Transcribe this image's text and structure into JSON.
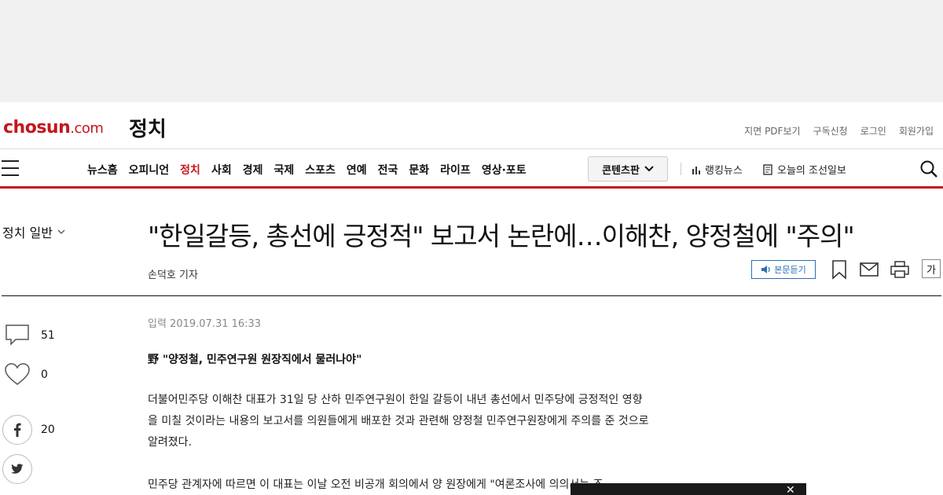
{
  "brand": {
    "logo_main": "chosun",
    "logo_suffix": ".com",
    "section": "정치",
    "accent_color": "#c4161c"
  },
  "util_links": [
    "지면 PDF보기",
    "구독신청",
    "로그인",
    "회원가입"
  ],
  "nav": {
    "items": [
      "뉴스홈",
      "오피니언",
      "정치",
      "사회",
      "경제",
      "국제",
      "스포츠",
      "연예",
      "전국",
      "문화",
      "라이프",
      "영상·포토"
    ],
    "active": "정치",
    "content_button": "콘텐츠판",
    "ranking": "랭킹뉴스",
    "today": "오늘의 조선일보",
    "icons": [
      "hamburger-menu-icon",
      "bar-chart-icon",
      "newspaper-icon",
      "search-icon",
      "chevron-down-icon"
    ]
  },
  "breadcrumb": {
    "label": "정치 일반"
  },
  "article": {
    "headline": "\"한일갈등, 총선에 긍정적\" 보고서 논란에…이해찬, 양정철에 \"주의\"",
    "byline": "손덕호 기자",
    "date": "입력 2019.07.31 16:33",
    "subhead": "野 \"양정철, 민주연구원 원장직에서 물러나야\"",
    "paragraphs": [
      "더불어민주당 이해찬 대표가 31일 당 산하 민주연구원이 한일 갈등이 내년 총선에서 민주당에 긍정적인 영향을 미칠 것이라는 내용의 보고서를 의원들에게 배포한 것과 관련해 양정철 민주연구원장에게 주의를 준 것으로 알려졌다.",
      "민주당 관계자에 따르면 이 대표는 이날 오전 비공개 회의에서 양 원장에게 \"여론조사에 의의서는 조"
    ]
  },
  "tools": {
    "listen_label": "본문듣기",
    "font_label": "가",
    "icons": [
      "speaker-icon",
      "bookmark-icon",
      "mail-icon",
      "print-icon"
    ]
  },
  "social": {
    "comments": "51",
    "likes": "0",
    "facebook": "20",
    "icons": [
      "comment-icon",
      "heart-icon",
      "facebook-icon",
      "twitter-icon"
    ]
  },
  "video_popup": {
    "close_label": "✕"
  }
}
